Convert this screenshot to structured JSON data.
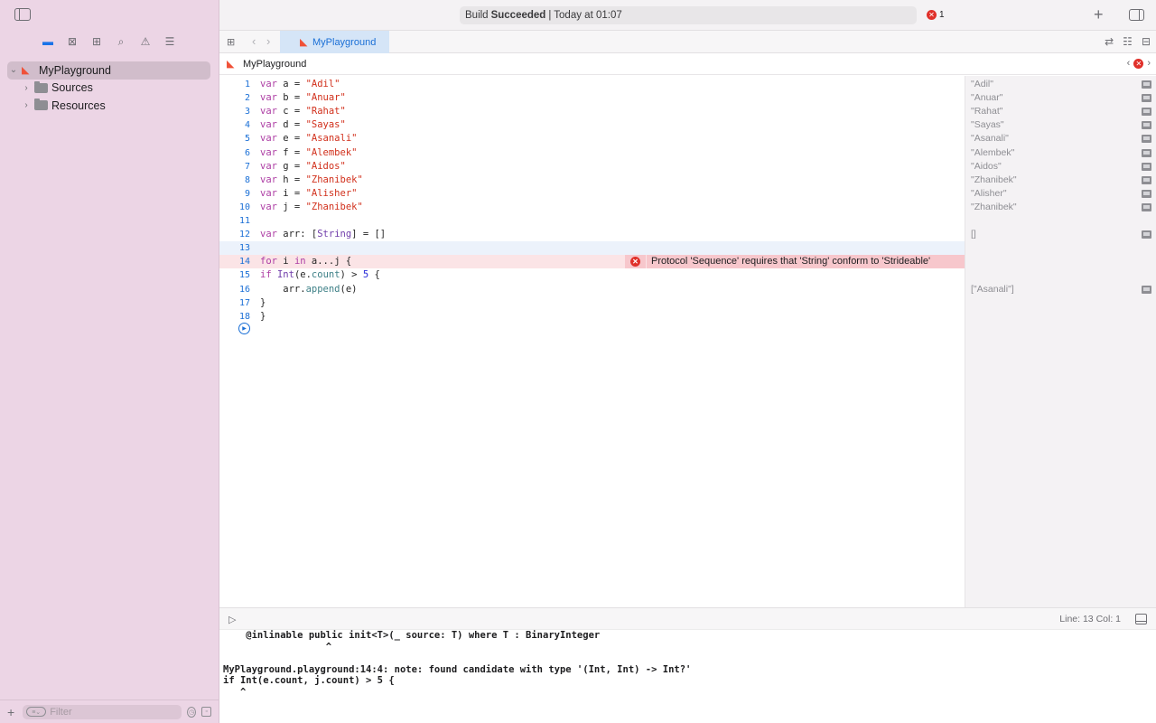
{
  "sidebar": {
    "nav_icons": [
      "folder-icon",
      "source-control-icon",
      "symbol-icon",
      "find-icon",
      "issue-icon",
      "report-icon"
    ],
    "tree": [
      {
        "label": "MyPlayground",
        "icon": "swift-icon",
        "expanded": true,
        "selected": true
      },
      {
        "label": "Sources",
        "icon": "folder-icon",
        "expanded": false
      },
      {
        "label": "Resources",
        "icon": "folder-icon",
        "expanded": false
      }
    ],
    "filter_placeholder": "Filter"
  },
  "toolbar": {
    "status_prefix": "Build",
    "status_bold": "Succeeded",
    "status_suffix": "| Today at 01:07",
    "error_count": "1"
  },
  "tabbar": {
    "tab_label": "MyPlayground"
  },
  "jumpbar": {
    "file": "MyPlayground"
  },
  "editor": {
    "lines": [
      {
        "n": "1",
        "html": "<span class=\"kw\">var</span> a = <span class=\"str\">\"Adil\"</span>",
        "result": "\"Adil\""
      },
      {
        "n": "2",
        "html": "<span class=\"kw\">var</span> b = <span class=\"str\">\"Anuar\"</span>",
        "result": "\"Anuar\""
      },
      {
        "n": "3",
        "html": "<span class=\"kw\">var</span> c = <span class=\"str\">\"Rahat\"</span>",
        "result": "\"Rahat\""
      },
      {
        "n": "4",
        "html": "<span class=\"kw\">var</span> d = <span class=\"str\">\"Sayas\"</span>",
        "result": "\"Sayas\""
      },
      {
        "n": "5",
        "html": "<span class=\"kw\">var</span> e = <span class=\"str\">\"Asanali\"</span>",
        "result": "\"Asanali\""
      },
      {
        "n": "6",
        "html": "<span class=\"kw\">var</span> f = <span class=\"str\">\"Alembek\"</span>",
        "result": "\"Alembek\""
      },
      {
        "n": "7",
        "html": "<span class=\"kw\">var</span> g = <span class=\"str\">\"Aidos\"</span>",
        "result": "\"Aidos\""
      },
      {
        "n": "8",
        "html": "<span class=\"kw\">var</span> h = <span class=\"str\">\"Zhanibek\"</span>",
        "result": "\"Zhanibek\""
      },
      {
        "n": "9",
        "html": "<span class=\"kw\">var</span> i = <span class=\"str\">\"Alisher\"</span>",
        "result": "\"Alisher\""
      },
      {
        "n": "10",
        "html": "<span class=\"kw\">var</span> j = <span class=\"str\">\"Zhanibek\"</span>",
        "result": "\"Zhanibek\""
      },
      {
        "n": "11",
        "html": "",
        "result": ""
      },
      {
        "n": "12",
        "html": "<span class=\"kw\">var</span> arr: [<span class=\"ty\">String</span>] = []",
        "result": "[]"
      },
      {
        "n": "13",
        "html": "",
        "result": "",
        "current": true
      },
      {
        "n": "14",
        "html": "<span class=\"kw\">for</span> i <span class=\"kw\">in</span> a...j {",
        "result": "",
        "error": "Protocol 'Sequence' requires that 'String' conform to 'Strideable'"
      },
      {
        "n": "15",
        "html": "<span class=\"kw\">if</span> <span class=\"ty\">Int</span>(e.<span class=\"fn\">count</span>) > <span class=\"num\">5</span> {",
        "result": ""
      },
      {
        "n": "16",
        "html": "    arr.<span class=\"fn\">append</span>(e)",
        "result": "[\"Asanali\"]"
      },
      {
        "n": "17",
        "html": "}",
        "result": ""
      },
      {
        "n": "18",
        "html": "}",
        "result": ""
      }
    ]
  },
  "debug": {
    "position": "Line: 13  Col: 1",
    "console": [
      "    @inlinable public init<T>(_ source: T) where T : BinaryInteger",
      "                  ^",
      "",
      "MyPlayground.playground:14:4: note: found candidate with type '(Int, Int) -> Int?'",
      "if Int(e.count, j.count) > 5 {",
      "   ^"
    ]
  }
}
